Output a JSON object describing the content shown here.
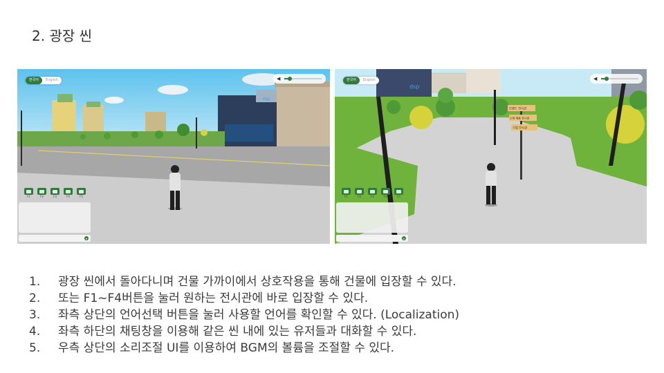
{
  "slide": {
    "title": "2. 광장 씬"
  },
  "ui": {
    "language": {
      "options": [
        "한국어",
        "English"
      ],
      "selected": 0
    },
    "sound": {
      "icon": "speaker-icon",
      "volume": 0.15
    },
    "f_buttons": [
      "F1",
      "F2",
      "F3",
      "F4",
      "F5"
    ],
    "chat": {
      "send_icon": "send-icon"
    },
    "accent": "#2f7a3c"
  },
  "left_shot": {
    "sign": "dsp"
  },
  "right_shot": {
    "sign": "dsp",
    "signpost": [
      "브랜드 전시관",
      "소재 제품 전시관",
      "기업 전시관"
    ]
  },
  "bullets": [
    {
      "num": "1.",
      "text": "광장 씬에서 돌아다니며 건물 가까이에서 상호작용을 통해 건물에 입장할 수 있다."
    },
    {
      "num": "2.",
      "text": "또는 F1~F4버튼을 눌러 원하는 전시관에 바로 입장할 수 있다."
    },
    {
      "num": "3.",
      "text": "좌측 상단의 언어선택 버튼을 눌러 사용할 언어를 확인할 수 있다.  (Localization)"
    },
    {
      "num": "4.",
      "text": "좌측 하단의 채팅창을 이용해 같은 씬 내에 있는 유저들과 대화할 수 있다."
    },
    {
      "num": "5.",
      "text": "우측 상단의 소리조절 UI를 이용하여 BGM의 볼륨을 조절할 수 있다."
    }
  ]
}
